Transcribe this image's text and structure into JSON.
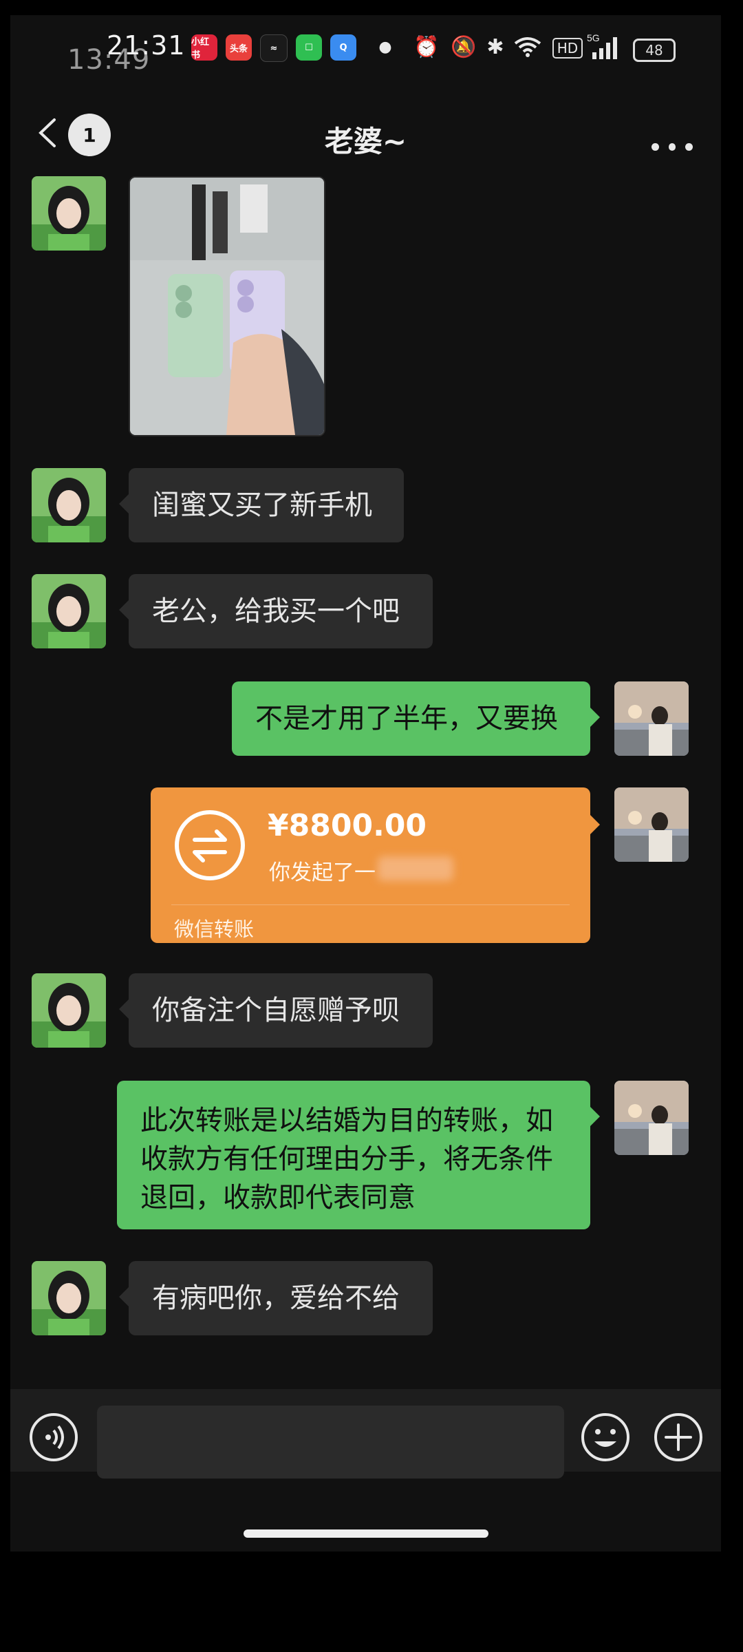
{
  "status_bar": {
    "time_main": "13:49",
    "time_overlay": "21:31",
    "apps": [
      "小红书",
      "头条"
    ],
    "network": "5G",
    "hd": "HD",
    "battery": "48"
  },
  "header": {
    "unread_count": "1",
    "title": "老婆~"
  },
  "messages": [
    {
      "side": "left",
      "type": "image"
    },
    {
      "side": "left",
      "type": "text",
      "text": "闺蜜又买了新手机"
    },
    {
      "side": "left",
      "type": "text",
      "text": "老公，给我买一个吧"
    },
    {
      "side": "right",
      "type": "text",
      "text": "不是才用了半年，又要换"
    },
    {
      "side": "right",
      "type": "transfer",
      "amount": "¥8800.00",
      "desc": "你发起了一",
      "footer": "微信转账"
    },
    {
      "side": "left",
      "type": "text",
      "text": "你备注个自愿赠予呗"
    },
    {
      "side": "right",
      "type": "text",
      "text": "此次转账是以结婚为目的转账，如收款方有任何理由分手，将无条件退回，收款即代表同意"
    },
    {
      "side": "left",
      "type": "text",
      "text": "有病吧你，爱给不给"
    }
  ],
  "colors": {
    "incoming_bubble": "#2c2c2c",
    "outgoing_bubble": "#5ac264",
    "transfer_card": "#f0963f",
    "background": "#111111"
  }
}
